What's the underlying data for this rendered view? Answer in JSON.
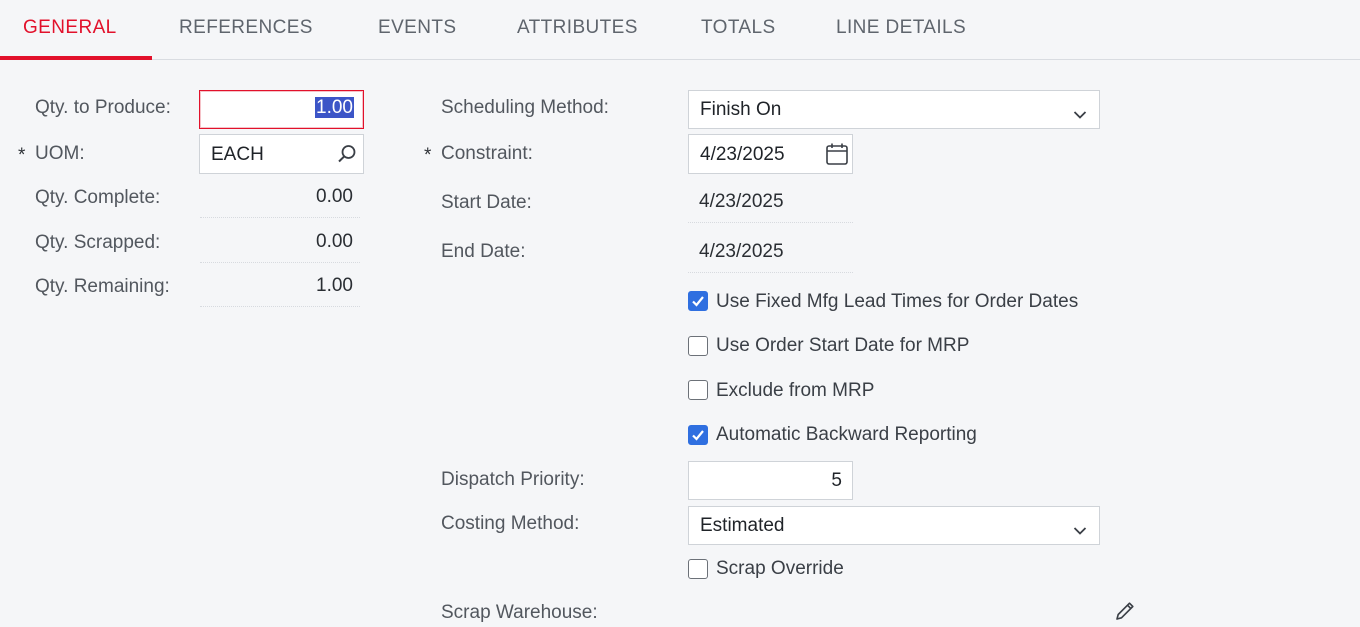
{
  "tabs": [
    {
      "label": "GENERAL",
      "active": true
    },
    {
      "label": "REFERENCES"
    },
    {
      "label": "EVENTS"
    },
    {
      "label": "ATTRIBUTES"
    },
    {
      "label": "TOTALS"
    },
    {
      "label": "LINE DETAILS"
    }
  ],
  "left": {
    "qty_to_produce": {
      "label": "Qty. to Produce:",
      "value": "1.00"
    },
    "uom": {
      "label": "UOM:",
      "value": "EACH",
      "required": "*"
    },
    "qty_complete": {
      "label": "Qty. Complete:",
      "value": "0.00"
    },
    "qty_scrapped": {
      "label": "Qty. Scrapped:",
      "value": "0.00"
    },
    "qty_remaining": {
      "label": "Qty. Remaining:",
      "value": "1.00"
    }
  },
  "right": {
    "scheduling_method": {
      "label": "Scheduling Method:",
      "value": "Finish On"
    },
    "constraint": {
      "label": "Constraint:",
      "value": "4/23/2025",
      "required": "*"
    },
    "start_date": {
      "label": "Start Date:",
      "value": "4/23/2025"
    },
    "end_date": {
      "label": "End Date:",
      "value": "4/23/2025"
    },
    "checkboxes": [
      {
        "label": "Use Fixed Mfg Lead Times for Order Dates",
        "checked": true
      },
      {
        "label": "Use Order Start Date for MRP",
        "checked": false
      },
      {
        "label": "Exclude from MRP",
        "checked": false
      },
      {
        "label": "Automatic Backward Reporting",
        "checked": true
      }
    ],
    "dispatch_priority": {
      "label": "Dispatch Priority:",
      "value": "5"
    },
    "costing_method": {
      "label": "Costing Method:",
      "value": "Estimated"
    },
    "scrap_override": {
      "label": "Scrap Override",
      "checked": false
    },
    "scrap_warehouse": {
      "label": "Scrap Warehouse:"
    }
  },
  "colors": {
    "accent": "#e2112b",
    "checkbox": "#2f6fe0",
    "selection": "#3c55c7"
  },
  "icons": [
    "search-icon",
    "chevron-down-icon",
    "calendar-icon",
    "pencil-icon",
    "check-icon"
  ]
}
